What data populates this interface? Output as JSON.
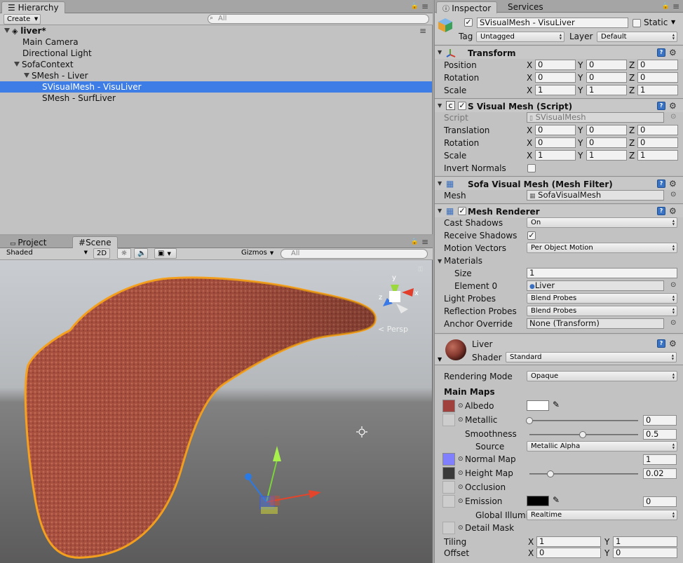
{
  "hierarchy": {
    "tab": "Hierarchy",
    "create_label": "Create",
    "search_placeholder": "All",
    "scene_name": "liver*",
    "items": [
      {
        "label": "Main Camera"
      },
      {
        "label": "Directional Light"
      },
      {
        "label": "SofaContext"
      },
      {
        "label": "SMesh - Liver"
      },
      {
        "label": "SVisualMesh - VisuLiver"
      },
      {
        "label": "SMesh - SurfLiver"
      }
    ]
  },
  "scene_panel": {
    "tabs": [
      "Project",
      "Scene"
    ],
    "shading_mode": "Shaded",
    "mode_2d": "2D",
    "gizmos_label": "Gizmos",
    "search_placeholder": "All",
    "persp_label": "Persp",
    "gizmo_axes": {
      "x": "x",
      "y": "y",
      "z": "z"
    }
  },
  "inspector": {
    "tabs": [
      "Inspector",
      "Services"
    ],
    "object_name": "SVisualMesh - VisuLiver",
    "static_label": "Static",
    "tag_label": "Tag",
    "tag_value": "Untagged",
    "layer_label": "Layer",
    "layer_value": "Default",
    "transform": {
      "title": "Transform",
      "position_label": "Position",
      "rotation_label": "Rotation",
      "scale_label": "Scale",
      "position": [
        "0",
        "0",
        "0"
      ],
      "rotation": [
        "0",
        "0",
        "0"
      ],
      "scale": [
        "1",
        "1",
        "1"
      ]
    },
    "svisual": {
      "title": "S Visual Mesh (Script)",
      "script_label": "Script",
      "script_value": "SVisualMesh",
      "translation_label": "Translation",
      "rotation_label": "Rotation",
      "scale_label": "Scale",
      "translation": [
        "0",
        "0",
        "0"
      ],
      "rotation": [
        "0",
        "0",
        "0"
      ],
      "scale": [
        "1",
        "1",
        "1"
      ],
      "invert_normals_label": "Invert Normals"
    },
    "mesh_filter": {
      "title": "Sofa Visual Mesh (Mesh Filter)",
      "mesh_label": "Mesh",
      "mesh_value": "SofaVisualMesh"
    },
    "renderer": {
      "title": "Mesh Renderer",
      "cast_shadows_label": "Cast Shadows",
      "cast_shadows_value": "On",
      "receive_shadows_label": "Receive Shadows",
      "motion_vectors_label": "Motion Vectors",
      "motion_vectors_value": "Per Object Motion",
      "materials_label": "Materials",
      "size_label": "Size",
      "size_value": "1",
      "element0_label": "Element 0",
      "element0_value": "Liver",
      "light_probes_label": "Light Probes",
      "light_probes_value": "Blend Probes",
      "reflection_probes_label": "Reflection Probes",
      "reflection_probes_value": "Blend Probes",
      "anchor_override_label": "Anchor Override",
      "anchor_override_value": "None (Transform)"
    },
    "material": {
      "name": "Liver",
      "shader_label": "Shader",
      "shader_value": "Standard",
      "rendering_mode_label": "Rendering Mode",
      "rendering_mode_value": "Opaque",
      "main_maps_label": "Main Maps",
      "albedo_label": "Albedo",
      "metallic_label": "Metallic",
      "metallic_value": "0",
      "smoothness_label": "Smoothness",
      "smoothness_value": "0.5",
      "source_label": "Source",
      "source_value": "Metallic Alpha",
      "normal_map_label": "Normal Map",
      "normal_map_value": "1",
      "height_map_label": "Height Map",
      "height_map_value": "0.02",
      "occlusion_label": "Occlusion",
      "emission_label": "Emission",
      "emission_value": "0",
      "global_illum_label": "Global Illumi",
      "global_illum_value": "Realtime",
      "detail_mask_label": "Detail Mask",
      "tiling_label": "Tiling",
      "offset_label": "Offset",
      "tiling": [
        "1",
        "1"
      ],
      "offset": [
        "0",
        "0"
      ]
    }
  },
  "colors": {
    "selection": "#3e7de6",
    "albedo_swatch": "#a0413d",
    "normal_swatch": "#8080ff",
    "height_swatch": "#3a3a3a",
    "liver_outline": "#f5a01e"
  }
}
